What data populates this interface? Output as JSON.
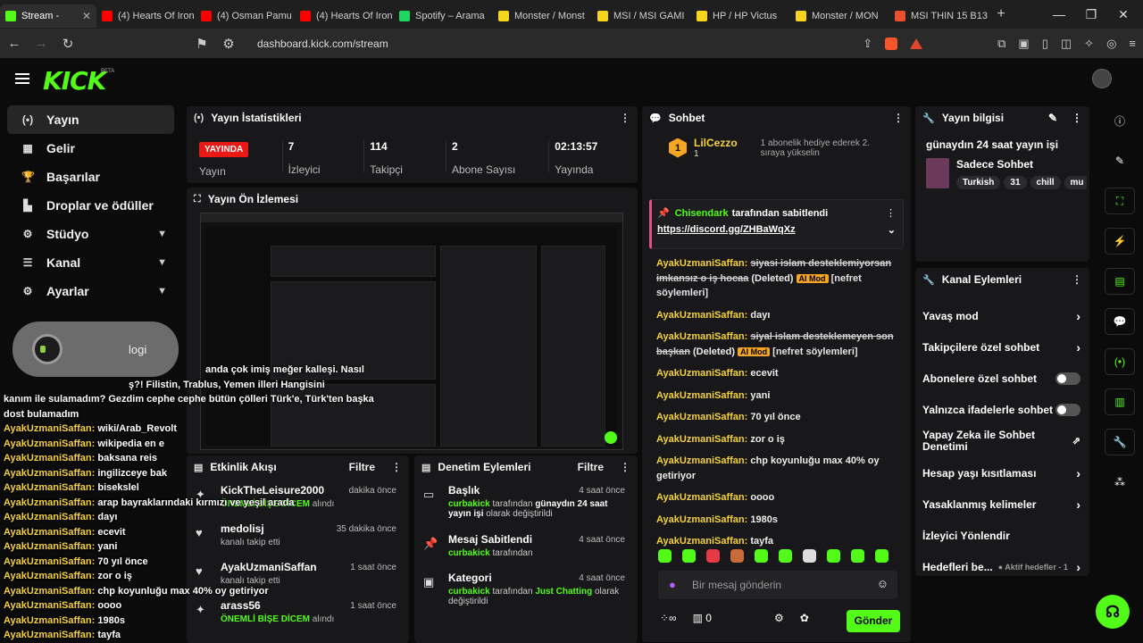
{
  "browser": {
    "tabs": [
      {
        "label": "Stream -",
        "color": "#53fc18",
        "active": true
      },
      {
        "label": "(4) Hearts Of Iron",
        "color": "#ff0000"
      },
      {
        "label": "(4) Osman Pamu",
        "color": "#ff0000"
      },
      {
        "label": "(4) Hearts Of Iron",
        "color": "#ff0000"
      },
      {
        "label": "Spotify – Arama",
        "color": "#1ed760"
      },
      {
        "label": "Monster / Monst",
        "color": "#f7d51d"
      },
      {
        "label": "MSI / MSI GAMI",
        "color": "#f7d51d"
      },
      {
        "label": "HP / HP Victus",
        "color": "#f7d51d"
      },
      {
        "label": "Monster / MON",
        "color": "#f7d51d"
      },
      {
        "label": "MSI THIN 15 B13",
        "color": "#e8502f"
      }
    ],
    "url": "dashboard.kick.com/stream"
  },
  "header": {
    "logo": "KICK",
    "beta": "BETA"
  },
  "sidebar": {
    "items": [
      {
        "label": "Yayın",
        "icon": "(•)"
      },
      {
        "label": "Gelir",
        "icon": "▦"
      },
      {
        "label": "Başarılar",
        "icon": "🏆"
      },
      {
        "label": "Droplar ve ödüller",
        "icon": "▙"
      },
      {
        "label": "Stüdyo",
        "icon": "⚙"
      },
      {
        "label": "Kanal",
        "icon": "☰"
      },
      {
        "label": "Ayarlar",
        "icon": "⚙"
      }
    ]
  },
  "stats_panel": {
    "title": "Yayın İstatistikleri",
    "live": "YAYINDA",
    "live_label": "Yayın",
    "viewers": "7",
    "viewers_label": "İzleyici",
    "followers": "114",
    "followers_label": "Takipçi",
    "subs": "2",
    "subs_label": "Abone Sayısı",
    "uptime": "02:13:57",
    "uptime_label": "Yayında"
  },
  "preview_panel": {
    "title": "Yayın Ön İzlemesi"
  },
  "webcam": {
    "brand": "logi"
  },
  "overlay_chat": [
    {
      "u": "",
      "m": "anda çok imiş meğer kalleşi. Nasıl"
    },
    {
      "u": "",
      "m": "ş?! Filistin, Trablus, Yemen illeri Hangisini"
    },
    {
      "u": "",
      "m": "kanım ile sulamadım? Gezdim cephe cephe bütün çölleri Türk'e, Türk'ten başka"
    },
    {
      "u": "",
      "m": "dost bulamadım"
    },
    {
      "u": "AyakUzmaniSaffan:",
      "m": "wiki/Arab_Revolt"
    },
    {
      "u": "AyakUzmaniSaffan:",
      "m": "wikipedia en e"
    },
    {
      "u": "AyakUzmaniSaffan:",
      "m": "baksana reis"
    },
    {
      "u": "AyakUzmaniSaffan:",
      "m": "ingilizceye bak"
    },
    {
      "u": "AyakUzmaniSaffan:",
      "m": "bisekslel"
    },
    {
      "u": "AyakUzmaniSaffan:",
      "m": "arap bayraklarındaki kırmızı ve yeşil arada"
    },
    {
      "u": "AyakUzmaniSaffan:",
      "m": "dayı"
    },
    {
      "u": "AyakUzmaniSaffan:",
      "m": "ecevit"
    },
    {
      "u": "AyakUzmaniSaffan:",
      "m": "yani"
    },
    {
      "u": "AyakUzmaniSaffan:",
      "m": "70 yıl önce"
    },
    {
      "u": "AyakUzmaniSaffan:",
      "m": "zor o iş"
    },
    {
      "u": "AyakUzmaniSaffan:",
      "m": "chp koyunluğu max 40% oy getiriyor"
    },
    {
      "u": "AyakUzmaniSaffan:",
      "m": "oooo"
    },
    {
      "u": "AyakUzmaniSaffan:",
      "m": "1980s"
    },
    {
      "u": "AyakUzmaniSaffan:",
      "m": "tayfa"
    }
  ],
  "activity_panel": {
    "title": "Etkinlik Akışı",
    "filter": "Filtre",
    "items": [
      {
        "name": "KickTheLeisure2000",
        "sub": "ÖNEMLİ BİŞE DİCEM",
        "sub2": "alındı",
        "time": "dakika önce"
      },
      {
        "name": "medolisj",
        "sub": "",
        "sub2": "kanalı takip etti",
        "time": "35 dakika önce"
      },
      {
        "name": "AyakUzmaniSaffan",
        "sub": "",
        "sub2": "kanalı takip etti",
        "time": "1 saat önce"
      },
      {
        "name": "arass56",
        "sub": "ÖNEMLİ BİŞE DİCEM",
        "sub2": "alındı",
        "time": "1 saat önce"
      }
    ]
  },
  "mod_panel": {
    "title": "Denetim Eylemleri",
    "filter": "Filtre",
    "items": [
      {
        "name": "Başlık",
        "who": "curbakick",
        "text": "tarafından",
        "extra": "günaydın 24 saat yayın işi",
        "tail": "olarak değiştirildi",
        "time": "4 saat önce"
      },
      {
        "name": "Mesaj Sabitlendi",
        "who": "curbakick",
        "text": "tarafından",
        "extra": "",
        "tail": "",
        "time": "4 saat önce"
      },
      {
        "name": "Kategori",
        "who": "curbakick",
        "text": "tarafından",
        "extra": "Just Chatting",
        "tail": "olarak değiştirildi",
        "time": "4 saat önce"
      }
    ]
  },
  "chat_panel": {
    "title": "Sohbet",
    "top_user": "LilCezzo",
    "top_badge": "1",
    "top_count": "1",
    "top_text": "1 abonelik hediye ederek 2. sıraya yükselin",
    "pinned_user": "Chisendark",
    "pinned_by": "tarafından sabitlendi",
    "pinned_link": "https://discord.gg/ZHBaWqXz",
    "messages": [
      {
        "u": "AyakUzmaniSaffan:",
        "m": "siyasi islam desteklemiyorsan imkansız o iş hocaa",
        "deleted": true,
        "del": "(Deleted)",
        "tag": "AI Mod",
        "note": "[nefret söylemleri]"
      },
      {
        "u": "AyakUzmaniSaffan:",
        "m": "dayı"
      },
      {
        "u": "AyakUzmaniSaffan:",
        "m": "siyal islam desteklemeyen son başkan",
        "deleted": true,
        "del": "(Deleted)",
        "tag": "AI Mod",
        "note": "[nefret söylemleri]"
      },
      {
        "u": "AyakUzmaniSaffan:",
        "m": "ecevit"
      },
      {
        "u": "AyakUzmaniSaffan:",
        "m": "yani"
      },
      {
        "u": "AyakUzmaniSaffan:",
        "m": "70 yıl önce"
      },
      {
        "u": "AyakUzmaniSaffan:",
        "m": "zor o iş"
      },
      {
        "u": "AyakUzmaniSaffan:",
        "m": "chp koyunluğu max 40% oy getiriyor"
      },
      {
        "u": "AyakUzmaniSaffan:",
        "m": "oooo"
      },
      {
        "u": "AyakUzmaniSaffan:",
        "m": "1980s"
      },
      {
        "u": "AyakUzmaniSaffan:",
        "m": "tayfa"
      }
    ],
    "input_placeholder": "Bir mesaj gönderin",
    "points": "0",
    "send": "Gönder"
  },
  "info_panel": {
    "title": "Yayın bilgisi",
    "stream_title": "günaydın 24 saat yayın işi",
    "category": "Sadece Sohbet",
    "tags": [
      "Turkish",
      "31",
      "chill",
      "mu"
    ]
  },
  "actions_panel": {
    "title": "Kanal Eylemleri",
    "items": [
      {
        "label": "Yavaş mod",
        "kind": "arrow"
      },
      {
        "label": "Takipçilere özel sohbet",
        "kind": "arrow"
      },
      {
        "label": "Abonelere özel sohbet",
        "kind": "toggle"
      },
      {
        "label": "Yalnızca ifadelerle sohbet",
        "kind": "toggle"
      },
      {
        "label": "Yapay Zeka ile Sohbet Denetimi",
        "kind": "chart"
      },
      {
        "label": "Hesap yaşı kısıtlaması",
        "kind": "arrow"
      },
      {
        "label": "Yasaklanmış kelimeler",
        "kind": "arrow"
      },
      {
        "label": "İzleyici Yönlendir",
        "kind": "none"
      },
      {
        "label": "Hedefleri be...",
        "kind": "arrow",
        "extra": "● Aktif hedefler - 1"
      }
    ]
  },
  "colors": {
    "brand": "#53fc18",
    "live": "#e91916",
    "username": "#f6d23a",
    "panel": "#18181b"
  }
}
